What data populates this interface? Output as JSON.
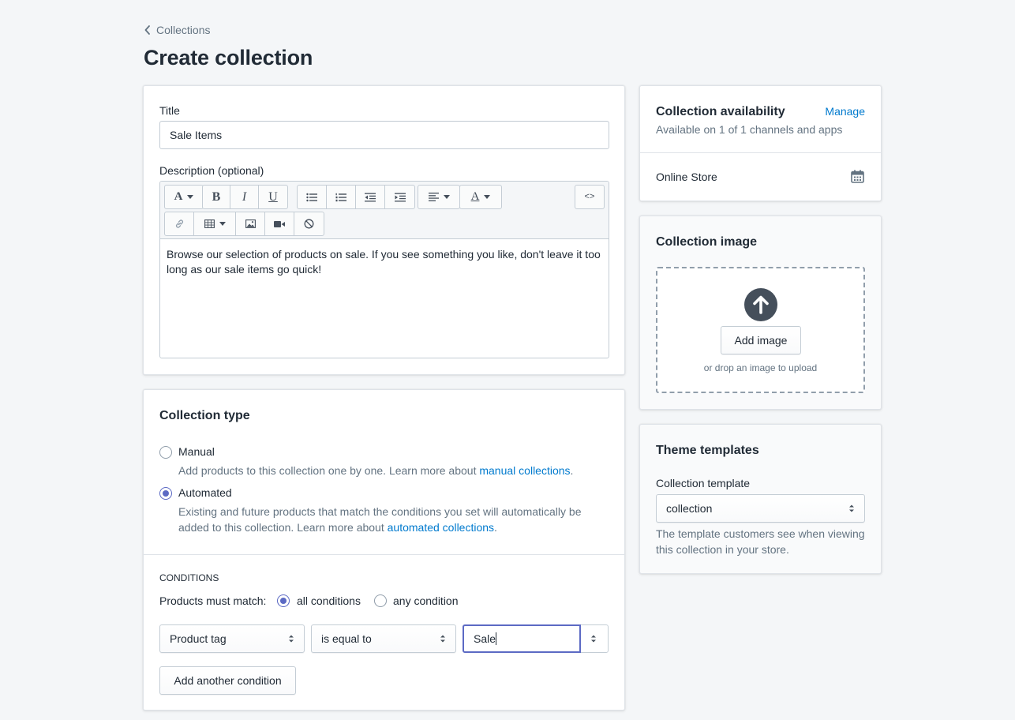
{
  "breadcrumb": {
    "label": "Collections",
    "icon": "chevron-left-icon"
  },
  "page": {
    "title": "Create collection"
  },
  "title_field": {
    "label": "Title",
    "value": "Sale Items"
  },
  "description": {
    "label": "Description (optional)",
    "body": "Browse our selection of products on sale. If you see something you like, don't leave it too long as our sale items go quick!",
    "html_toggle_label": "<>",
    "toolbar_icons": [
      "font-icon",
      "bold-icon",
      "italic-icon",
      "underline-icon",
      "bullet-list-icon",
      "numbered-list-icon",
      "outdent-icon",
      "indent-icon",
      "align-icon",
      "text-color-icon",
      "code-view-icon",
      "link-icon",
      "table-icon",
      "image-icon",
      "video-icon",
      "clear-format-icon"
    ]
  },
  "collection_type": {
    "title": "Collection type",
    "manual": {
      "label": "Manual",
      "help": "Add products to this collection one by one. Learn more about ",
      "link": "manual collections",
      "checked": false
    },
    "automated": {
      "label": "Automated",
      "help_line1": "Existing and future products that match the conditions you set will automatically be",
      "help_line2": "added to this collection. Learn more about ",
      "link": "automated collections",
      "checked": true
    }
  },
  "conditions": {
    "heading": "CONDITIONS",
    "match_label": "Products must match:",
    "all_label": "all conditions",
    "any_label": "any condition",
    "selected": "all",
    "rule": {
      "field": "Product tag",
      "operator": "is equal to",
      "value": "Sale"
    },
    "add_button": "Add another condition"
  },
  "availability": {
    "title": "Collection availability",
    "manage_link": "Manage",
    "summary": "Available on 1 of 1 channels and apps",
    "channel": "Online Store",
    "channel_icon": "calendar-icon"
  },
  "collection_image": {
    "title": "Collection image",
    "add_button": "Add image",
    "hint": "or drop an image to upload",
    "icon": "upload-arrow-icon"
  },
  "theme_templates": {
    "title": "Theme templates",
    "field_label": "Collection template",
    "selected": "collection",
    "help_line1": "The template customers see when viewing",
    "help_line2": "this collection in your store."
  },
  "colors": {
    "background": "#f4f6f8",
    "link": "#007ace",
    "accent": "#5c6ac4",
    "text": "#212b36",
    "subdued": "#637381"
  }
}
